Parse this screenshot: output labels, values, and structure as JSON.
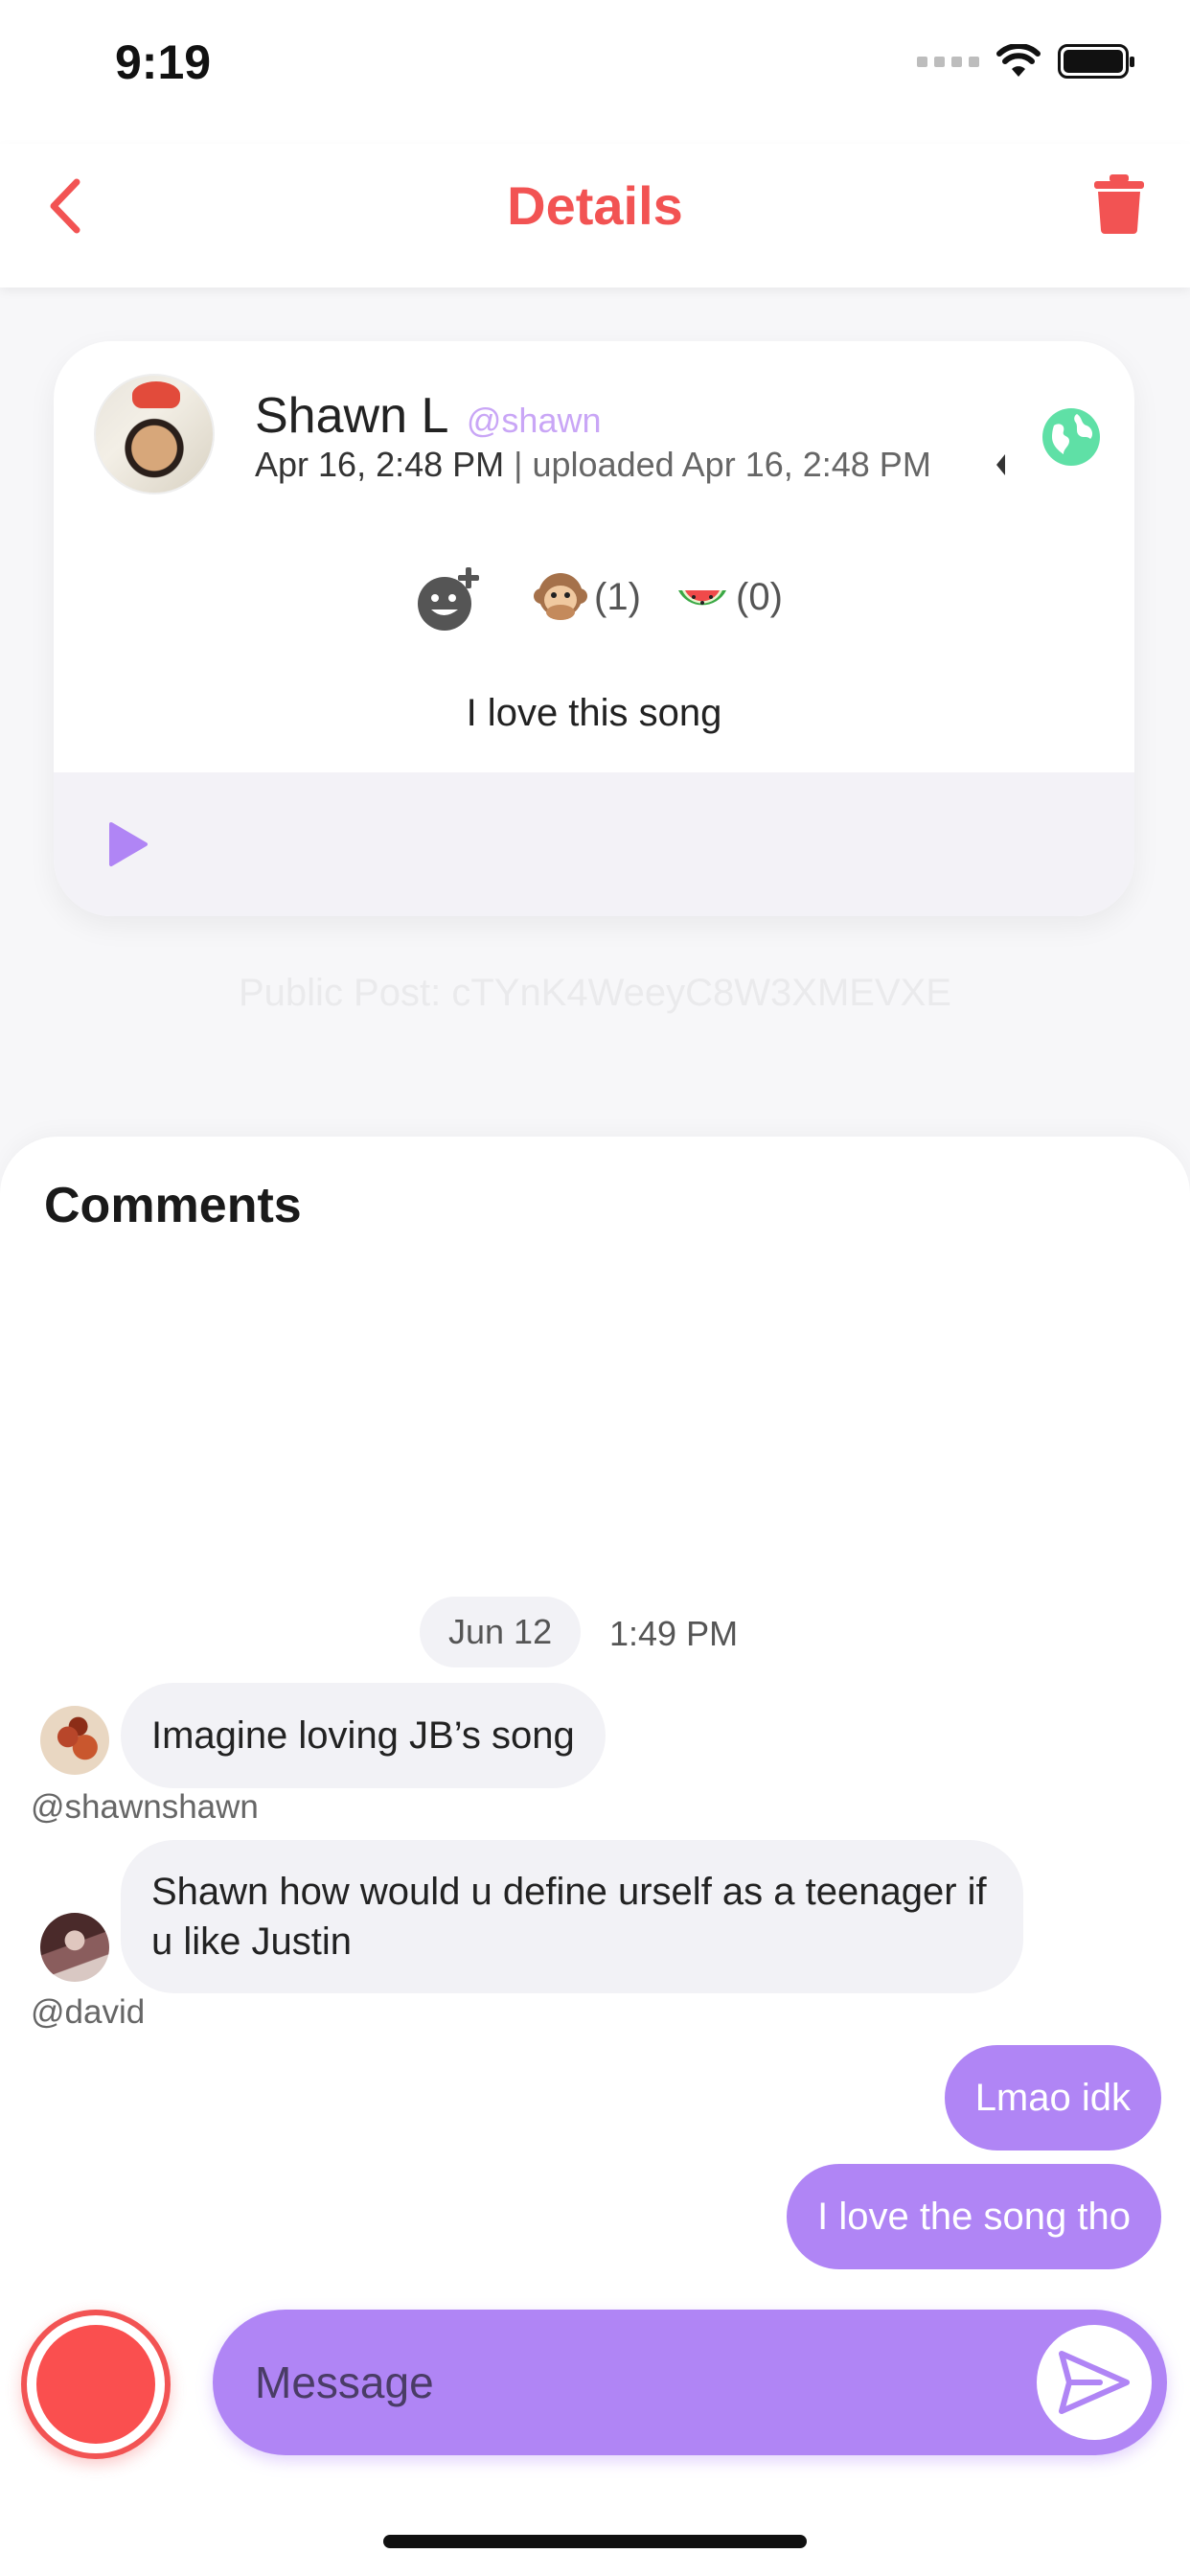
{
  "status_bar": {
    "time": "9:19"
  },
  "nav": {
    "title": "Details",
    "back_icon": "chevron-left-icon",
    "delete_icon": "trash-icon"
  },
  "colors": {
    "accent": "#f25353",
    "bubble_out": "#b085f5",
    "handle": "#c9a6f6",
    "globe": "#5fe0a6"
  },
  "post": {
    "author": "Shawn L",
    "handle": "@shawn",
    "date": "Apr 16, 2:48 PM",
    "separator": " | ",
    "uploaded": "uploaded Apr 16, 2:48 PM",
    "visibility_icon": "globe-icon",
    "reactions": [
      {
        "emoji": "monkey-emoji",
        "count": "(1)"
      },
      {
        "emoji": "watermelon-emoji",
        "count": "(0)"
      }
    ],
    "text": "I love this song",
    "id_label": "Public Post: cTYnK4WeeyC8W3XMEVXE"
  },
  "comments": {
    "title": "Comments",
    "date_pill": "Jun 12",
    "time": "1:49 PM",
    "messages": [
      {
        "text": "Imagine loving JB’s song",
        "handle": "@shawnshawn"
      },
      {
        "text": "Shawn how would u define urself as a teenager if u like Justin",
        "handle": "@david"
      },
      {
        "text": "Lmao idk"
      },
      {
        "text": "I love the song tho"
      }
    ]
  },
  "composer": {
    "placeholder": "Message"
  }
}
